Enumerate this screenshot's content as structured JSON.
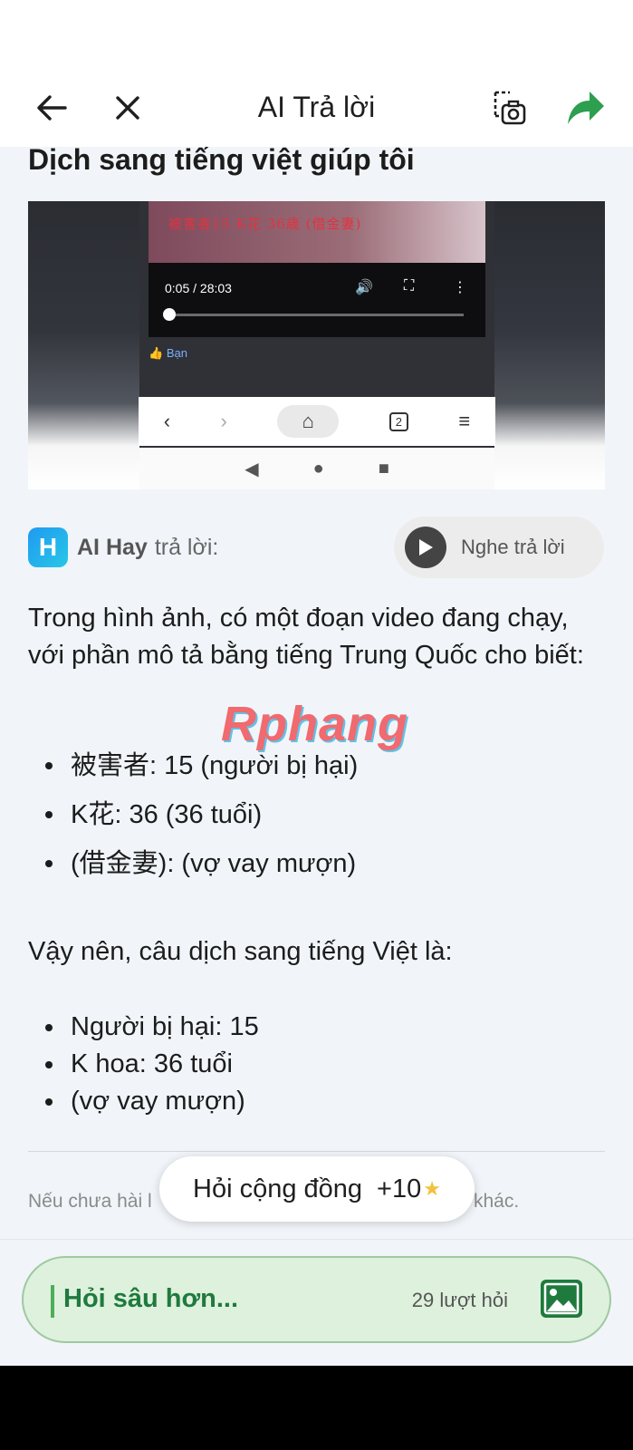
{
  "header": {
    "title": "AI Trả lời"
  },
  "question": "Dịch sang tiếng việt giúp tôi",
  "screenshot": {
    "overlay_text": "被害者15  K花  36歳  (借金妻)",
    "time": "0:05 / 28:03",
    "liked_label": "Bạn",
    "tab_count": "2"
  },
  "ai": {
    "name": "AI Hay",
    "suffix": "trả lời:",
    "listen_label": "Nghe trả lời",
    "logo_letter": "H"
  },
  "answer": {
    "intro": "Trong hình ảnh, có một đoạn video đang chạy, với phần mô tả bằng tiếng Trung Quốc cho biết:",
    "items1": [
      "被害者: 15 (người bị hại)",
      "K花: 36 (36 tuổi)",
      "(借金妻): (vợ vay mượn)"
    ],
    "conclusion": "Vậy nên, câu dịch sang tiếng Việt là:",
    "items2": [
      "Người bị hại: 15",
      "K hoa: 36 tuổi",
      "(vợ vay mượn)"
    ]
  },
  "watermark": "Rphang",
  "footnote_left": "Nếu chưa hài l",
  "footnote_right": "khác.",
  "community": {
    "label": "Hỏi cộng đồng",
    "points": "+10"
  },
  "ask": {
    "placeholder": "Hỏi sâu hơn...",
    "count": "29 lượt hỏi"
  },
  "colors": {
    "accent": "#1f7a3e",
    "share": "#2e9e4f",
    "askbox_bg": "#def1dd"
  }
}
